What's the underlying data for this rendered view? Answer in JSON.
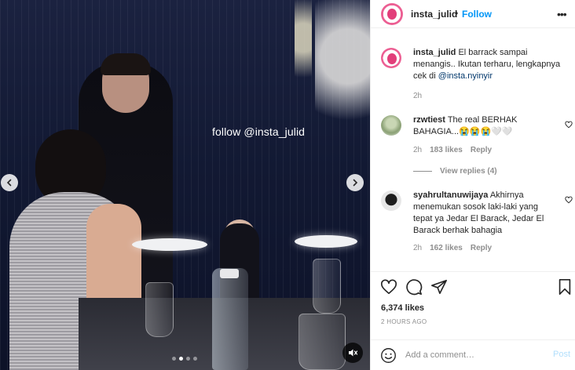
{
  "media": {
    "watermark": "follow @insta_julid",
    "nav_left_icon": "chevron-left-icon",
    "nav_right_icon": "chevron-right-icon",
    "carousel_dots": 4,
    "carousel_active_index": 1
  },
  "header": {
    "username": "insta_julid",
    "separator": "•",
    "follow_label": "Follow",
    "more_label": "•••"
  },
  "caption": {
    "username": "insta_julid",
    "text": " El barrack sampai menangis.. Ikutan terharu, lengkapnya cek di ",
    "mention": "@insta.nyinyir",
    "time": "2h"
  },
  "comments": [
    {
      "username": "rzwtiest",
      "text": " The real BERHAK BAHAGIA...😭😭😭🤍🤍",
      "time": "2h",
      "likes": "183 likes",
      "reply_label": "Reply",
      "view_replies": "View replies (4)"
    },
    {
      "username": "syahrultanuwijaya",
      "text": " Akhirnya menemukan sosok laki-laki yang tepat ya Jedar El Barack, Jedar El Barack berhak bahagia",
      "time": "2h",
      "likes": "162 likes",
      "reply_label": "Reply"
    }
  ],
  "actions": {
    "likes": "6,374 likes",
    "time_ago": "2 HOURS AGO"
  },
  "comment_box": {
    "placeholder": "Add a comment…",
    "post_label": "Post"
  },
  "colors": {
    "accent": "#0095f6",
    "post_disabled": "#b2dffc",
    "muted": "#8e8e8e"
  }
}
